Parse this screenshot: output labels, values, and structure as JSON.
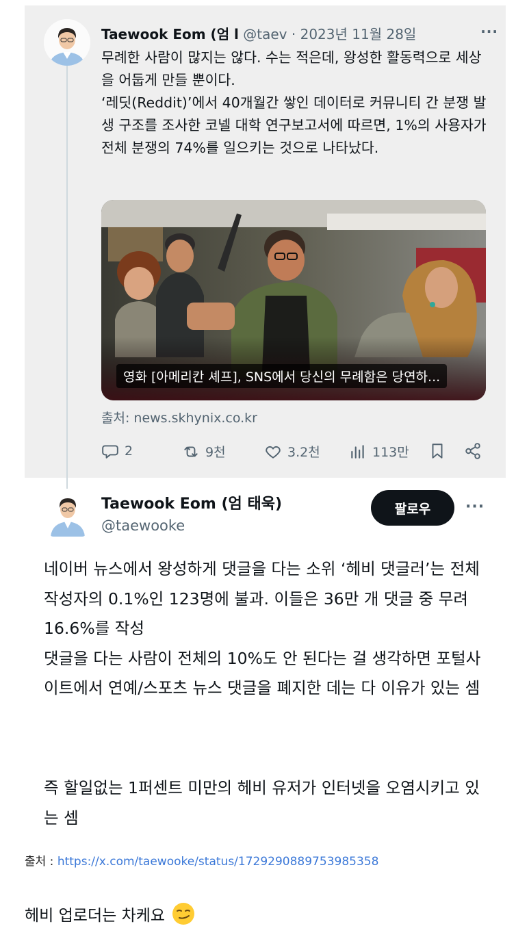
{
  "quoted_tweet": {
    "author_name": "Taewook Eom (엄 l",
    "handle": "@taev",
    "separator": "·",
    "date": "2023년 11월 28일",
    "more": "···",
    "paragraph1": "무례한 사람이 많지는 않다. 수는 적은데, 왕성한 활동력으로 세상을 어둡게 만들 뿐이다.",
    "paragraph2": "‘레딧(Reddit)’에서 40개월간 쌓인 데이터로 커뮤니티 간 분쟁 발생 구조를 조사한 코넬 대학 연구보고서에 따르면, 1%의 사용자가 전체 분쟁의 74%를 일으키는 것으로 나타났다.",
    "card_caption": "영화 [아메리칸 셰프], SNS에서 당신의 무례함은 당연하...",
    "source": "출처: news.skhynix.co.kr",
    "replies": "2",
    "retweets": "9천",
    "likes": "3.2천",
    "views": "113만"
  },
  "main_tweet": {
    "author_name": "Taewook Eom (엄 태욱)",
    "handle": "@taewooke",
    "follow_label": "팔로우",
    "more": "···",
    "line1": "네이버 뉴스에서 왕성하게 댓글을 다는 소위 ‘헤비 댓글러’는 전체 작성자의 0.1%인 123명에 불과. 이들은 36만 개 댓글 중 무려 16.6%를 작성",
    "line2": "댓글을 다는 사람이 전체의 10%도 안 된다는 걸 생각하면 포털사이트에서 연예/스포츠 뉴스 댓글을 폐지한 데는 다 이유가 있는 셈",
    "line3": "즉 할일없는 1퍼센트 미만의 헤비 유저가 인터넷을 오염시키고 있는 셈"
  },
  "post": {
    "source_label": "출처 :",
    "source_url": "https://x.com/taewooke/status/1729290889753985358",
    "footer_text": "헤비 업로더는 차케요"
  },
  "icons": [
    "reply-icon",
    "retweet-icon",
    "like-icon",
    "views-icon",
    "bookmark-icon",
    "share-icon",
    "smirk-emoji-icon"
  ],
  "colors": {
    "muted": "#536471",
    "link": "#3b78d8",
    "button": "#0f1419",
    "card_bg": "#efefef"
  }
}
